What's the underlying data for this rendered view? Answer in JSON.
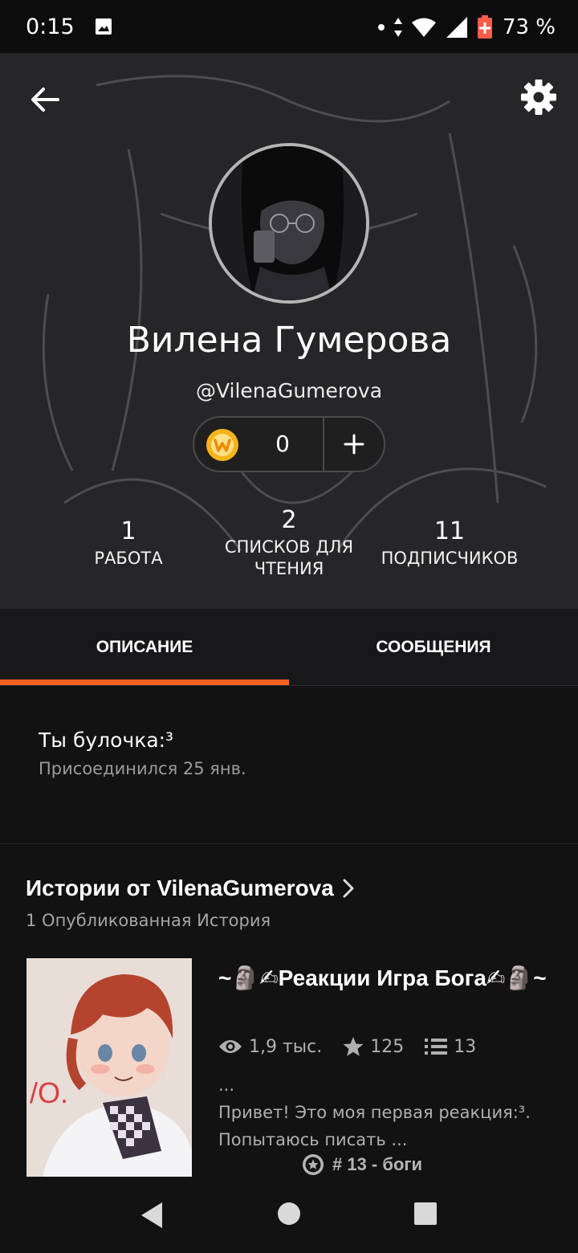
{
  "status_bar": {
    "time": "0:15",
    "battery": "73 %",
    "icons": [
      "image-icon",
      "dot-icon",
      "data-arrows-icon",
      "wifi-icon",
      "signal-icon",
      "battery-icon"
    ]
  },
  "header": {
    "display_name": "Вилена Гумерова",
    "username": "@VilenaGumerova",
    "coins": "0",
    "add_symbol": "+",
    "stats": [
      {
        "value": "1",
        "label": "РАБОТА"
      },
      {
        "value": "2",
        "label": "СПИСКОВ ДЛЯ ЧТЕНИЯ"
      },
      {
        "value": "11",
        "label": "ПОДПИСЧИКОВ"
      }
    ]
  },
  "tabs": [
    {
      "label": "ОПИСАНИЕ",
      "active": true
    },
    {
      "label": "СООБЩЕНИЯ",
      "active": false
    }
  ],
  "description": {
    "text": "Ты булочка:³",
    "joined": "Присоединился 25 янв."
  },
  "stories": {
    "title": "Истории от VilenaGumerova",
    "count": "1 Опубликованная История",
    "items": [
      {
        "title": "~🗿✍Реакции Игра Бога✍🗿~",
        "views": "1,9 тыс.",
        "votes": "125",
        "parts": "13",
        "description": "...\nПривет! Это моя первая реакция:³. Попытаюсь писать ...",
        "tag": "# 13 - боги"
      }
    ]
  },
  "colors": {
    "accent": "#ff6122",
    "header_bg": "#262527",
    "page_bg": "#121212",
    "coin": "#f6b41a"
  }
}
